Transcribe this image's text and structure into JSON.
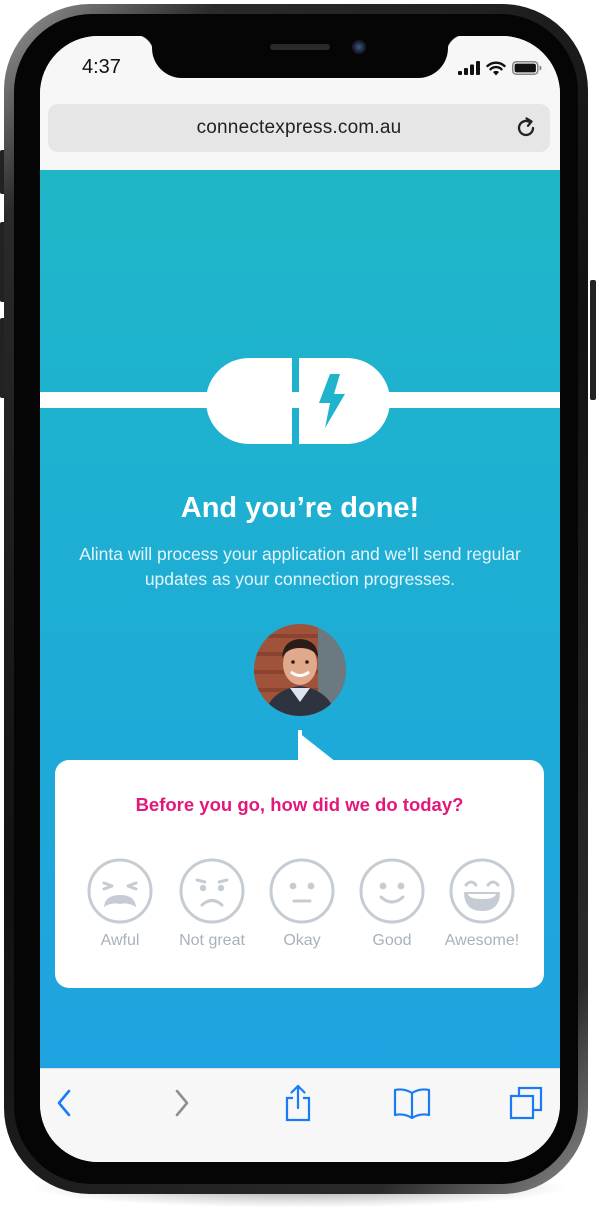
{
  "status_bar": {
    "time": "4:37"
  },
  "browser": {
    "url": "connectexpress.com.au"
  },
  "page": {
    "title": "And you’re done!",
    "subtitle": "Alinta will process your application and we’ll send regular updates as your connection progresses."
  },
  "feedback": {
    "question": "Before you go, how did we do today?",
    "ratings": [
      {
        "label": "Awful",
        "icon": "awful-face-icon"
      },
      {
        "label": "Not great",
        "icon": "not-great-face-icon"
      },
      {
        "label": "Okay",
        "icon": "okay-face-icon"
      },
      {
        "label": "Good",
        "icon": "good-face-icon"
      },
      {
        "label": "Awesome!",
        "icon": "awesome-face-icon"
      }
    ]
  },
  "toolbar": {
    "items": [
      "back-icon",
      "forward-icon",
      "share-icon",
      "bookmarks-icon",
      "tabs-icon"
    ]
  },
  "colors": {
    "accent_pink": "#e3187a",
    "gradient_top": "#1fb7c8",
    "gradient_bottom": "#1fa2e0",
    "ios_blue": "#1a7cf5",
    "face_grey": "#c5ccd3"
  }
}
